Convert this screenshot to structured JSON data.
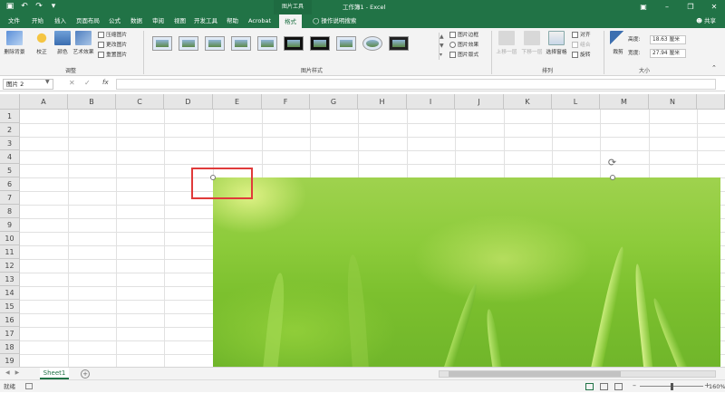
{
  "titlebar": {
    "tools_tab": "图片工具",
    "doc_title": "工作簿1 - Excel",
    "qat": [
      "save-icon",
      "undo-icon",
      "redo-icon",
      "customize-icon"
    ],
    "window": [
      "ribbon-display-icon",
      "minimize-icon",
      "restore-icon",
      "close-icon"
    ]
  },
  "tabs": {
    "items": [
      "文件",
      "开始",
      "插入",
      "页面布局",
      "公式",
      "数据",
      "审阅",
      "视图",
      "开发工具",
      "帮助",
      "Acrobat",
      "格式"
    ],
    "active": "格式",
    "tell_me": "操作说明搜索",
    "share": "共享"
  },
  "ribbon": {
    "adjust": {
      "remove_bg": "删除背景",
      "correct": "校正",
      "color": "颜色",
      "art_effect": "艺术效果",
      "compress": "压缩图片",
      "change": "更改图片",
      "reset": "重置图片",
      "group_label": "调整"
    },
    "styles": {
      "border": "图片边框",
      "effects": "图片效果",
      "layout": "图片版式",
      "group_label": "图片样式"
    },
    "arrange": {
      "forward": "上移一层",
      "backward": "下移一层",
      "selection_pane": "选择窗格",
      "align": "对齐",
      "group": "组合",
      "rotate": "旋转",
      "group_label": "排列"
    },
    "size": {
      "crop": "裁剪",
      "height_label": "高度:",
      "height_value": "18.63 厘米",
      "width_label": "宽度:",
      "width_value": "27.94 厘米",
      "group_label": "大小"
    }
  },
  "formula_bar": {
    "name_box": "图片 2",
    "fx": "fx",
    "content": ""
  },
  "grid": {
    "columns": [
      "A",
      "B",
      "C",
      "D",
      "E",
      "F",
      "G",
      "H",
      "I",
      "J",
      "K",
      "L",
      "M",
      "N"
    ],
    "rows": [
      "1",
      "2",
      "3",
      "4",
      "5",
      "6",
      "7",
      "8",
      "9",
      "10",
      "11",
      "12",
      "13",
      "14",
      "15",
      "16",
      "17",
      "18",
      "19"
    ]
  },
  "sheets": {
    "tabs": [
      "Sheet1"
    ],
    "active": "Sheet1"
  },
  "status": {
    "ready": "就绪",
    "zoom": "160%"
  },
  "colors": {
    "accent": "#217346",
    "highlight": "#e03a3a"
  }
}
